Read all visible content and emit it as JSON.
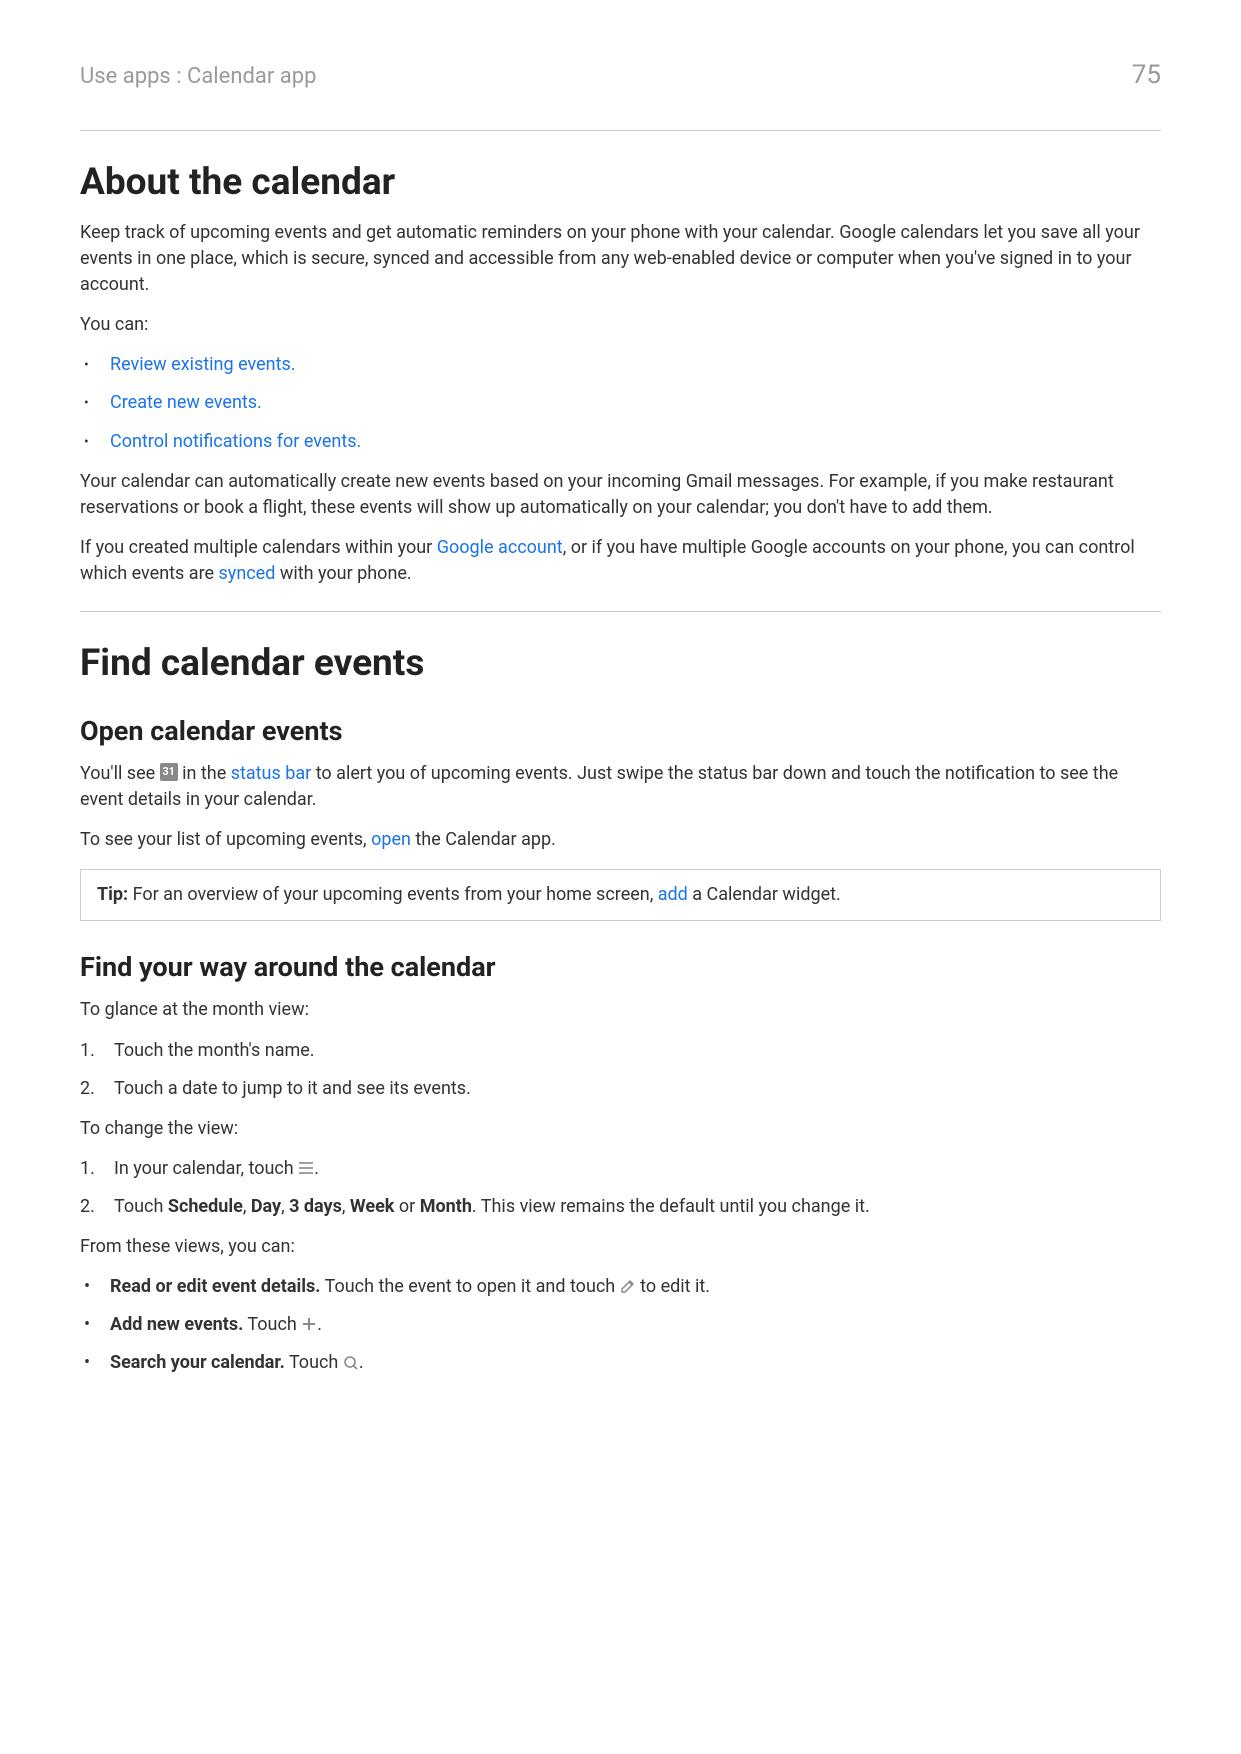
{
  "header": {
    "breadcrumb": "Use apps : Calendar app",
    "page_number": "75"
  },
  "section1": {
    "title": "About the calendar",
    "intro": "Keep track of upcoming events and get automatic reminders on your phone with your calendar. Google calendars let you save all your events in one place, which is secure, synced and accessible from any web-enabled device or computer when you've signed in to your account.",
    "you_can_label": "You can:",
    "links": [
      "Review existing events.",
      "Create new events.",
      "Control notifications for events."
    ],
    "auto_events": "Your calendar can automatically create new events based on your incoming Gmail messages. For example, if you make restaurant reservations or book a flight, these events will show up automatically on your calendar; you don't have to add them.",
    "multi_prefix": "If you created multiple calendars within your ",
    "multi_link1": "Google account",
    "multi_mid": ", or if you have multiple Google accounts on your phone, you can control which events are ",
    "multi_link2": "synced",
    "multi_suffix": " with your phone."
  },
  "section2": {
    "title": "Find calendar events",
    "sub1": {
      "title": "Open calendar events",
      "p1_a": "You'll see ",
      "icon_text": "31",
      "p1_b": " in the ",
      "status_bar": "status bar",
      "p1_c": " to alert you of upcoming events. Just swipe the status bar down and touch the notification to see the event details in your calendar.",
      "p2_a": "To see your list of upcoming events, ",
      "open_link": "open",
      "p2_b": " the Calendar app.",
      "tip_label": "Tip:",
      "tip_body_a": " For an overview of your upcoming events from your home screen, ",
      "tip_link": "add",
      "tip_body_b": " a Calendar widget."
    },
    "sub2": {
      "title": "Find your way around the calendar",
      "glance_label": "To glance at the month view:",
      "glance_steps": [
        "Touch the month's name.",
        "Touch a date to jump to it and see its events."
      ],
      "change_label": "To change the view:",
      "change_step1": "In your calendar, touch ",
      "change_step1_suffix": ".",
      "change_step2_a": "Touch ",
      "opt_schedule": "Schedule",
      "opt_day": "Day",
      "opt_3days": "3 days",
      "opt_week": "Week",
      "opt_month": "Month",
      "change_step2_b": ". This view remains the default until you change it.",
      "from_label": "From these views, you can:",
      "b1_bold": "Read or edit event details.",
      "b1_a": " Touch the event to open it and touch ",
      "b1_b": " to edit it.",
      "b2_bold": "Add new events.",
      "b2_a": " Touch ",
      "b2_b": ".",
      "b3_bold": "Search your calendar.",
      "b3_a": " Touch ",
      "b3_b": "."
    }
  }
}
